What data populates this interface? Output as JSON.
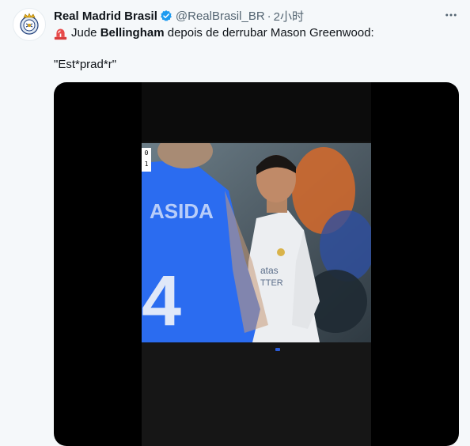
{
  "tweet": {
    "author_name": "Real Madrid Brasil",
    "author_handle": "@RealBrasil_BR",
    "separator": "·",
    "time": "2小时",
    "text_line1_pre": "Jude",
    "text_line1_bold": "Bellingham",
    "text_line1_post": "depois de derrubar Mason Greenwood:",
    "text_line2": "\"Est*prad*r\""
  },
  "media": {
    "scoreboard": [
      "0",
      "1"
    ],
    "shirt_number": "4",
    "shirt_text_blue": "ASIDA",
    "shirt_text_white": "atas\nTTER"
  },
  "colors": {
    "link": "#1d9bf0",
    "verified": "#1d9bf0",
    "secondary_text": "#536471",
    "background": "#f5f8fa"
  },
  "icons": {
    "verified": "verified-badge-icon",
    "more": "more-options-icon",
    "siren": "siren-emoji-icon"
  }
}
